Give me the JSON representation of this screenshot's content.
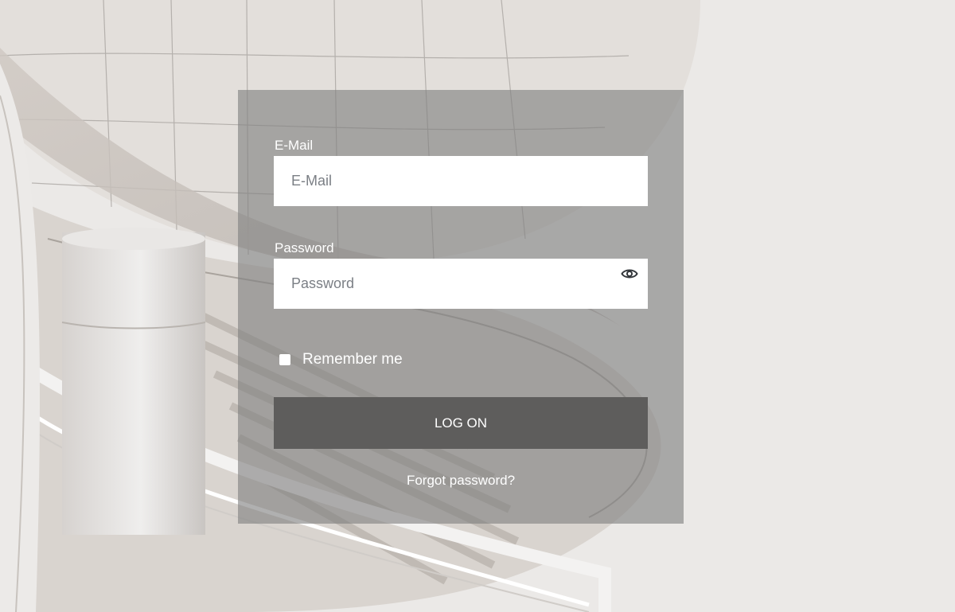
{
  "login": {
    "email_label": "E-Mail",
    "email_placeholder": "E-Mail",
    "password_label": "Password",
    "password_placeholder": "Password",
    "password_toggle_icon": "eye-icon",
    "remember_label": "Remember me",
    "remember_checked": false,
    "logon_label": "LOG ON",
    "forgot_label": "Forgot password?"
  },
  "colors": {
    "panel_overlay": "#808080",
    "logon_button": "#5e5d5c",
    "text": "#ffffff",
    "placeholder": "#7b7f85"
  }
}
